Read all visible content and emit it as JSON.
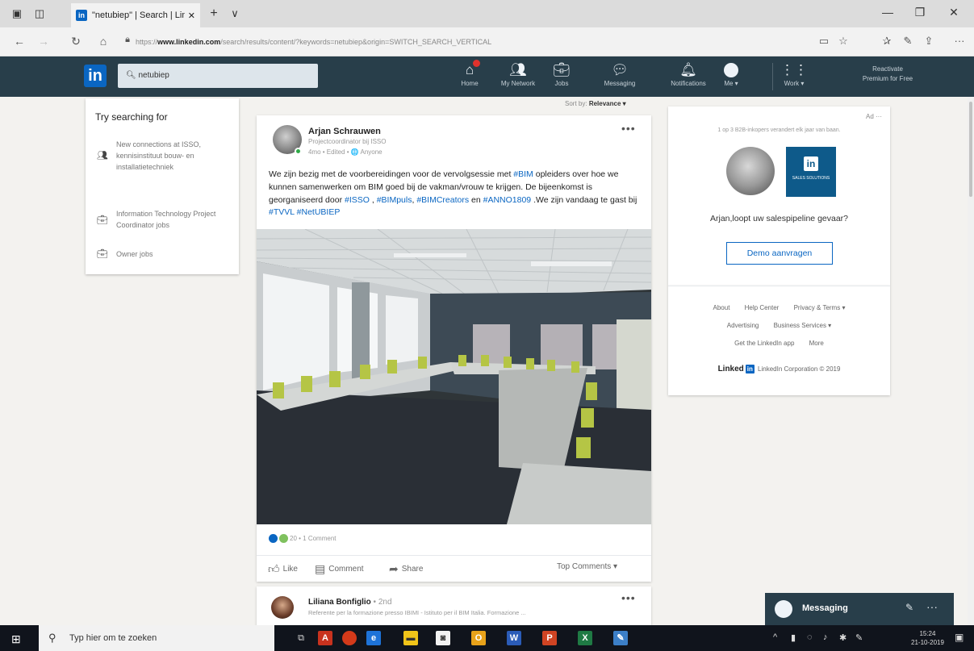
{
  "browser": {
    "tab_title": "\"netubiep\" | Search | Lin",
    "tab_close": "✕",
    "new_tab": "+",
    "tab_menu": "∨",
    "url_prefix": "https://",
    "url_domain": "www.linkedin.com",
    "url_rest": "/search/results/content/?keywords=netubiep&origin=SWITCH_SEARCH_VERTICAL",
    "win_min": "—",
    "win_max": "❐",
    "win_close": "✕"
  },
  "linkedin": {
    "logo": "in",
    "search_value": "netubiep",
    "nav": [
      {
        "label": "Home",
        "icon": "home-icon"
      },
      {
        "label": "My Network",
        "icon": "network-icon"
      },
      {
        "label": "Jobs",
        "icon": "briefcase-icon"
      },
      {
        "label": "Messaging",
        "icon": "messaging-icon"
      },
      {
        "label": "Notifications",
        "icon": "bell-icon"
      },
      {
        "label": "Me ▾",
        "icon": "me-avatar"
      },
      {
        "label": "Work ▾",
        "icon": "grid-icon"
      }
    ],
    "premium_line1": "Reactivate",
    "premium_line2": "Premium for Free"
  },
  "suggestions": {
    "title": "Try searching for",
    "items": [
      {
        "text": "New connections at ISSO, kennisinstituut bouw- en installatietechniek",
        "icon": "people-icon"
      },
      {
        "text": "Information Technology Project Coordinator jobs",
        "icon": "briefcase-icon"
      },
      {
        "text": "Owner jobs",
        "icon": "briefcase-icon"
      }
    ]
  },
  "sort": {
    "label": "Sort by:",
    "value": "Relevance ▾"
  },
  "post": {
    "author": "Arjan Schrauwen",
    "role": "Projectcoordinator bij ISSO",
    "meta": "4mo • Edited • 🌐 Anyone",
    "more": "•••",
    "text_parts": [
      {
        "t": "We zijn bezig met de voorbereidingen voor de vervolgsessie met ",
        "tag": false
      },
      {
        "t": "#BIM",
        "tag": true
      },
      {
        "t": " opleiders over hoe we kunnen samenwerken om BIM goed bij de vakman/vrouw te krijgen. De bijeenkomst is georganiseerd door ",
        "tag": false
      },
      {
        "t": "#ISSO",
        "tag": true
      },
      {
        "t": " , ",
        "tag": false
      },
      {
        "t": "#BIMpuls",
        "tag": true
      },
      {
        "t": ", ",
        "tag": false
      },
      {
        "t": "#BIMCreators",
        "tag": true
      },
      {
        "t": " en ",
        "tag": false
      },
      {
        "t": "#ANNO1809",
        "tag": true
      },
      {
        "t": " .We zijn vandaag te gast bij ",
        "tag": false
      },
      {
        "t": "#TVVL",
        "tag": true
      },
      {
        "t": " ",
        "tag": false
      },
      {
        "t": "#NetUBIEP",
        "tag": true
      }
    ],
    "reactions": "20 • 1 Comment",
    "actions": {
      "like": "Like",
      "comment": "Comment",
      "share": "Share",
      "sort": "Top Comments ▾"
    }
  },
  "post2": {
    "author": "Liliana Bonfiglio",
    "degree": " • 2nd",
    "role": "Referente per la formazione presso IBIMI - Istituto per il BIM Italia. Formazione ...",
    "more": "•••"
  },
  "ad": {
    "label": "Ad ···",
    "line": "1 op 3 B2B-inkopers verandert elk jaar van baan.",
    "logo_text": "SALES SOLUTIONS",
    "headline": "Arjan,loopt uw salespipeline gevaar?",
    "cta": "Demo aanvragen"
  },
  "footer": {
    "row1": [
      "About",
      "Help Center",
      "Privacy & Terms ▾"
    ],
    "row2": [
      "Advertising",
      "Business Services ▾"
    ],
    "row3": [
      "Get the LinkedIn app",
      "More"
    ],
    "brand": "Linked",
    "copyright": "LinkedIn Corporation © 2019"
  },
  "messaging": {
    "label": "Messaging",
    "compose": "✎",
    "more": "···"
  },
  "taskbar": {
    "search_placeholder": "Typ hier om te zoeken",
    "time": "15:24",
    "date": "21-10-2019"
  },
  "colors": {
    "li_nav_bg": "#283e4a",
    "li_blue": "#0a66c2",
    "page_bg": "#f3f2ef"
  }
}
